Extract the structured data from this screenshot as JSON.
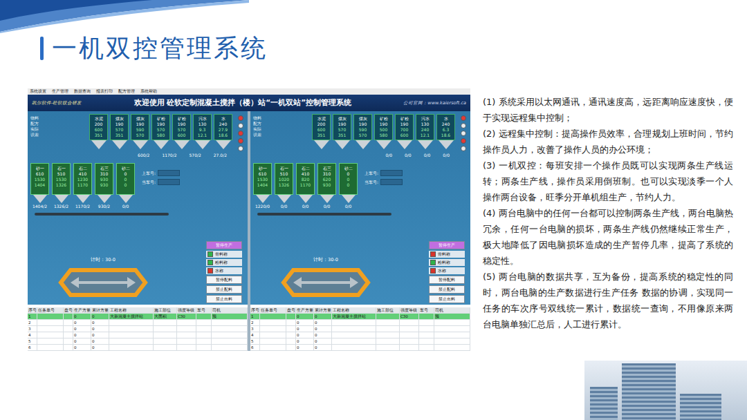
{
  "slide": {
    "title": "一机双控管理系统"
  },
  "app": {
    "menu": [
      "系统设置",
      "生产管理",
      "数据查询",
      "报表打印",
      "配方管理",
      "系统帮助"
    ],
    "header": {
      "brand": "凯尔软件-砼软联合研发",
      "title": "欢迎使用 砼软定制混凝土搅拌（楼）站“一机双站”控制管理系统",
      "site": "公司官网：www.kaiersoft.ca"
    },
    "legend": [
      "物料",
      "配方",
      "实际",
      "误差"
    ],
    "stations": [
      {
        "powders": [
          {
            "name": "水泥",
            "values": [
              "200",
              "600",
              "351"
            ]
          },
          {
            "name": "煤灰",
            "values": [
              "190",
              "570",
              "351"
            ]
          },
          {
            "name": "煤灰",
            "values": [
              "190",
              "590",
              "570"
            ]
          },
          {
            "name": "矿粉",
            "values": [
              "190",
              "570",
              "580"
            ]
          },
          {
            "name": "矿粉",
            "values": [
              "190",
              "570",
              "600"
            ]
          },
          {
            "name": "污水",
            "values": [
              "130",
              "9.3",
              "12.1"
            ]
          },
          {
            "name": "水",
            "values": [
              "240",
              "27.9",
              "18.6"
            ]
          }
        ],
        "scales": [
          "600/2",
          "1170/2",
          "570/2",
          "27.0/2"
        ],
        "lights": [
          {
            "on": true
          },
          {
            "on": false
          },
          {
            "on": true
          },
          {
            "on": true
          },
          {
            "on": false
          }
        ],
        "aggregates": [
          {
            "name": "砂一",
            "values": [
              "610",
              "1530",
              "1404"
            ],
            "reading": "1404/2"
          },
          {
            "name": "石一",
            "values": [
              "510",
              "1530",
              "1326"
            ],
            "reading": "1326/2"
          },
          {
            "name": "石二",
            "values": [
              "410",
              "1230",
              "1170"
            ],
            "reading": "1170/2"
          },
          {
            "name": "石三",
            "values": [
              "310",
              "930",
              "930"
            ],
            "reading": "930/2"
          },
          {
            "name": "砂二",
            "values": [
              "0",
              "0",
              "0"
            ],
            "reading": "0/0"
          }
        ],
        "car_labels": [
          "上车号:",
          "当车号:"
        ],
        "timer": "计时：30-0",
        "controls": [
          {
            "label": "暂停生产",
            "kind": "button",
            "checked": false
          },
          {
            "label": "骨料称",
            "kind": "check",
            "checked": true
          },
          {
            "label": "粉料称",
            "kind": "check",
            "checked": true
          },
          {
            "label": "水称",
            "kind": "check",
            "checked": false
          },
          {
            "label": "暂停配料",
            "kind": "button",
            "checked": false
          },
          {
            "label": "禁止配料",
            "kind": "button",
            "checked": false
          },
          {
            "label": "禁止出料",
            "kind": "button",
            "checked": false
          }
        ],
        "table": {
          "columns": [
            "序号",
            "任务单号",
            "盘号",
            "生产方量",
            "累计方量",
            "工程名称",
            "施工部位",
            "强度等级",
            "车号",
            "司机"
          ],
          "rows": [
            {
              "cells": [
                "1",
                "",
                "",
                "0",
                "0",
                "大新混凝土搅拌站",
                "大面积",
                "C30",
                "",
                "预"
              ],
              "selected": true
            },
            {
              "cells": [
                "2",
                "",
                "",
                "0",
                "0",
                "",
                "",
                "",
                "",
                ""
              ],
              "selected": false
            },
            {
              "cells": [
                "3",
                "",
                "",
                "0",
                "0",
                "",
                "",
                "",
                "",
                ""
              ],
              "selected": false
            },
            {
              "cells": [
                "4",
                "",
                "",
                "0",
                "0",
                "",
                "",
                "",
                "",
                ""
              ],
              "selected": false
            },
            {
              "cells": [
                "5",
                "",
                "",
                "0",
                "0",
                "",
                "",
                "",
                "",
                ""
              ],
              "selected": false
            },
            {
              "cells": [
                "6",
                "",
                "",
                "0",
                "0",
                "",
                "",
                "",
                "",
                ""
              ],
              "selected": false
            }
          ]
        }
      },
      {
        "powders": [
          {
            "name": "水泥",
            "values": [
              "200",
              "600",
              "351"
            ]
          },
          {
            "name": "煤灰",
            "values": [
              "190",
              "570",
              "351"
            ]
          },
          {
            "name": "煤灰",
            "values": [
              "190",
              "590",
              "570"
            ]
          },
          {
            "name": "矿粉",
            "values": [
              "190",
              "500",
              "580"
            ]
          },
          {
            "name": "矿粉",
            "values": [
              "190",
              "700",
              "600"
            ]
          },
          {
            "name": "污水",
            "values": [
              "130",
              "240",
              "12.1"
            ]
          },
          {
            "name": "水",
            "values": [
              "240",
              "6.3",
              "18.6"
            ]
          }
        ],
        "scales": [
          "0/0",
          "0/0",
          "0/0",
          "0/0"
        ],
        "lights": [
          {
            "on": true
          },
          {
            "on": false
          },
          {
            "on": false
          },
          {
            "on": true
          },
          {
            "on": false
          }
        ],
        "aggregates": [
          {
            "name": "砂一",
            "values": [
              "610",
              "1530",
              "1404"
            ],
            "reading": "1220/0"
          },
          {
            "name": "石一",
            "values": [
              "510",
              "1020",
              "1326"
            ],
            "reading": "0/0"
          },
          {
            "name": "石二",
            "values": [
              "410",
              "820",
              "1170"
            ],
            "reading": "0/0"
          },
          {
            "name": "石三",
            "values": [
              "310",
              "620",
              "930"
            ],
            "reading": "0/0"
          },
          {
            "name": "砂二",
            "values": [
              "0",
              "0",
              "0"
            ],
            "reading": "0/0"
          }
        ],
        "car_labels": [
          "上车号:",
          "当车号:"
        ],
        "timer": "计时：30-0",
        "controls": [
          {
            "label": "暂停生产",
            "kind": "button",
            "checked": false
          },
          {
            "label": "骨料称",
            "kind": "check",
            "checked": false
          },
          {
            "label": "粉料称",
            "kind": "check",
            "checked": true
          },
          {
            "label": "水称",
            "kind": "check",
            "checked": false
          },
          {
            "label": "暂停配料",
            "kind": "button",
            "checked": false
          },
          {
            "label": "禁止配料",
            "kind": "button",
            "checked": false
          },
          {
            "label": "禁止出料",
            "kind": "button",
            "checked": false
          }
        ],
        "table": {
          "columns": [
            "序号",
            "任务单号",
            "盘号",
            "生产方量",
            "累计方量",
            "工程名称",
            "施工部位",
            "强度等级",
            "车号",
            "司机"
          ],
          "rows": [
            {
              "cells": [
                "1",
                "",
                "",
                "0",
                "0",
                "大新混凝土搅拌站",
                "",
                "C30",
                "",
                "预"
              ],
              "selected": true
            },
            {
              "cells": [
                "2",
                "",
                "",
                "0",
                "0",
                "",
                "",
                "",
                "",
                ""
              ],
              "selected": false
            },
            {
              "cells": [
                "3",
                "",
                "",
                "0",
                "0",
                "",
                "",
                "",
                "",
                ""
              ],
              "selected": false
            },
            {
              "cells": [
                "4",
                "",
                "",
                "0",
                "0",
                "",
                "",
                "",
                "",
                ""
              ],
              "selected": false
            },
            {
              "cells": [
                "5",
                "",
                "",
                "0",
                "0",
                "",
                "",
                "",
                "",
                ""
              ],
              "selected": false
            },
            {
              "cells": [
                "6",
                "",
                "",
                "0",
                "0",
                "",
                "",
                "",
                "",
                ""
              ],
              "selected": false
            }
          ]
        }
      }
    ]
  },
  "points": [
    "(1) 系统采用以太网通讯，通讯速度高，远距离响应速度快，便于实现远程集中控制；",
    "(2) 远程集中控制：提高操作员效率，合理规划上班时间，节约操作员人力，改善了操作人员的办公环境；",
    "(3) 一机双控：每班安排一个操作员既可以实现两条生产线运转；两条生产线，操作员采用倒班制。也可以实现淡季一个人操作两台设备，旺季分开单机组生产，节约人力。",
    "(4) 两台电脑中的任何一台都可以控制两条生产线，两台电脑热冗余，任何一台电脑的损坏，两条生产线仍然继续正常生产，极大地降低了因电脑损坏造成的生产暂停几率，提高了系统的稳定性。",
    "(5) 两台电脑的数据共享，互为备份，提高系统的稳定性的同时，两台电脑的生产数据进行生产任务 数据的协调，实现同一任务的车次序号双线统一累计，数据统一查询，不用像原来两台电脑单独汇总后，人工进行累计。"
  ]
}
